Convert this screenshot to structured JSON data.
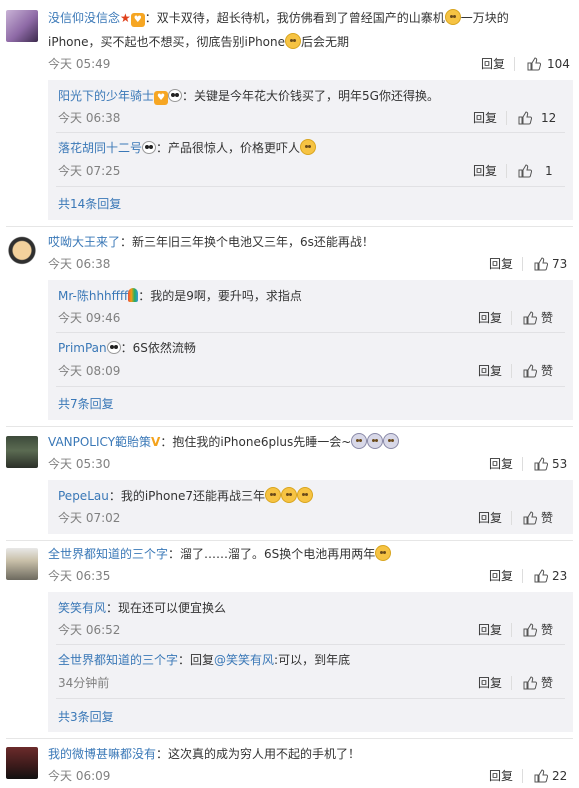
{
  "ui": {
    "reply_label": "回复",
    "like_label": "赞"
  },
  "c1": {
    "user": "没信仰没信念",
    "text_a": "：双卡双待，超长待机，我仿佛看到了曾经国产的山寨机",
    "text_b": "一万块的",
    "text_c": "iPhone，买不起也不想买，彻底告别iPhone",
    "text_d": "后会无期",
    "time": "今天 05:49",
    "likes": "104",
    "replies": [
      {
        "user": "阳光下的少年骑士",
        "text": "：关键是今年花大价钱买了，明年5G你还得换。",
        "time": "今天 06:38",
        "likes": "12"
      },
      {
        "user": "落花胡同十二号",
        "text": "：产品很惊人，价格更吓人",
        "time": "今天 07:25",
        "likes": "1"
      }
    ],
    "more": "共14条回复"
  },
  "c2": {
    "user": "哎呦大王来了",
    "text": "：新三年旧三年换个电池又三年，6s还能再战！",
    "time": "今天 06:38",
    "likes": "73",
    "replies": [
      {
        "user": "Mr-陈hhhffff",
        "text": "：我的是9啊，要升吗，求指点",
        "time": "今天 09:46"
      },
      {
        "user": "PrimPan",
        "text": "：6S依然流畅",
        "time": "今天 08:09"
      }
    ],
    "more": "共7条回复"
  },
  "c3": {
    "user": "VANPOLICY範貽策",
    "text": "：抱住我的iPhone6plus先睡一会~",
    "time": "今天 05:30",
    "likes": "53",
    "replies": [
      {
        "user": "PepeLau",
        "text": "：我的iPhone7还能再战三年",
        "time": "今天 07:02"
      }
    ]
  },
  "c4": {
    "user": "全世界都知道的三个字",
    "text": "：溜了……溜了。6S换个电池再用两年",
    "time": "今天 06:35",
    "likes": "23",
    "replies": [
      {
        "user": "笑笑有风",
        "text": "：现在还可以便宜换么",
        "time": "今天 06:52"
      },
      {
        "user": "全世界都知道的三个字",
        "text_a": "：回复",
        "mention": "@笑笑有风",
        "text_b": ":可以，到年底",
        "time": "34分钟前"
      }
    ],
    "more": "共3条回复"
  },
  "c5": {
    "user": "我的微博甚嘛都没有",
    "text": "：这次真的成为穷人用不起的手机了！",
    "time": "今天 06:09",
    "likes": "22"
  },
  "colors": {
    "link": "#3a78b7",
    "sub_bg": "#f2f2f5"
  }
}
